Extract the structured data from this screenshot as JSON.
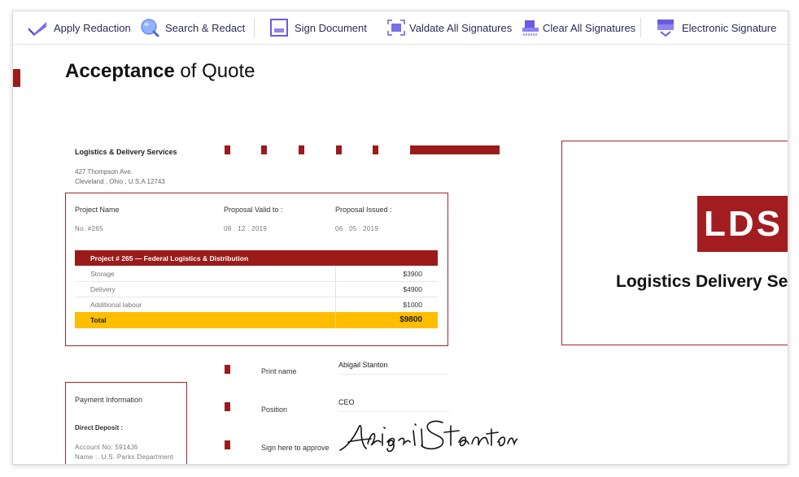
{
  "toolbar": {
    "apply_redaction": "Apply Redaction",
    "search_redact": "Search & Redact",
    "sign_document": "Sign Document",
    "validate_signatures": "Valdate All Signatures",
    "clear_signatures": "Clear All Signatures",
    "electronic_signature": "Electronic Signature"
  },
  "colors": {
    "accent": "#9b1b1b",
    "total_bar": "#ffbd00",
    "toolbar_icon": "#6a5be2"
  },
  "document": {
    "heading_bold": "Acceptance",
    "heading_rest": " of Quote",
    "company": "Logistics & Delivery Services",
    "address_1": "427 Thompson Ave.",
    "address_2": "Cleveland , Ohio , U.S.A 12743",
    "project_name_label": "Project Name",
    "project_name_value": "No. #265",
    "valid_to_label": "Proposal Valid to :",
    "valid_to_value": "08 . 12 . 2019",
    "issued_label": "Proposal Issued :",
    "issued_value": "06 . 05 . 2019",
    "table_header": "Project # 265 — Federal Logistics & Distribution",
    "rows": [
      {
        "item": "Storage",
        "amount": "$3900"
      },
      {
        "item": "Delivery",
        "amount": "$4900"
      },
      {
        "item": "Additional labour",
        "amount": "$1000"
      }
    ],
    "total_label": "Total",
    "total_value": "$9800",
    "print_name_label": "Print name",
    "print_name_value": "Abigail Stanton",
    "position_label": "Position",
    "position_value": "CEO",
    "sign_label": "Sign here to approve",
    "payment_title": "Payment Information",
    "deposit_label": "Direct Deposit :",
    "account": "Account No: 5914J6",
    "account_name": "Name :. U.S. Parks Department",
    "logo_text": "LDS",
    "brand_name": "Logistics Delivery Se"
  }
}
